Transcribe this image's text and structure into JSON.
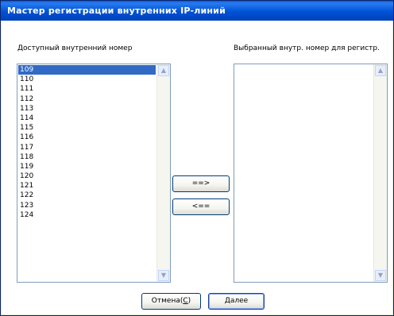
{
  "window": {
    "title": "Мастер регистрации внутренних IP-линий"
  },
  "left": {
    "label": "Доступный внутренний номер",
    "items": [
      "109",
      "110",
      "111",
      "112",
      "113",
      "114",
      "115",
      "116",
      "117",
      "118",
      "119",
      "120",
      "121",
      "122",
      "123",
      "124"
    ],
    "selected_index": 0
  },
  "right": {
    "label": "Выбранный внутр. номер для регистр.",
    "items": []
  },
  "buttons": {
    "add": "==>",
    "remove": "<==",
    "cancel_pre": "Отмена(",
    "cancel_key": "C",
    "cancel_post": ")",
    "next": "Далее"
  },
  "icons": {
    "scroll_up": "▲",
    "scroll_down": "▼"
  }
}
